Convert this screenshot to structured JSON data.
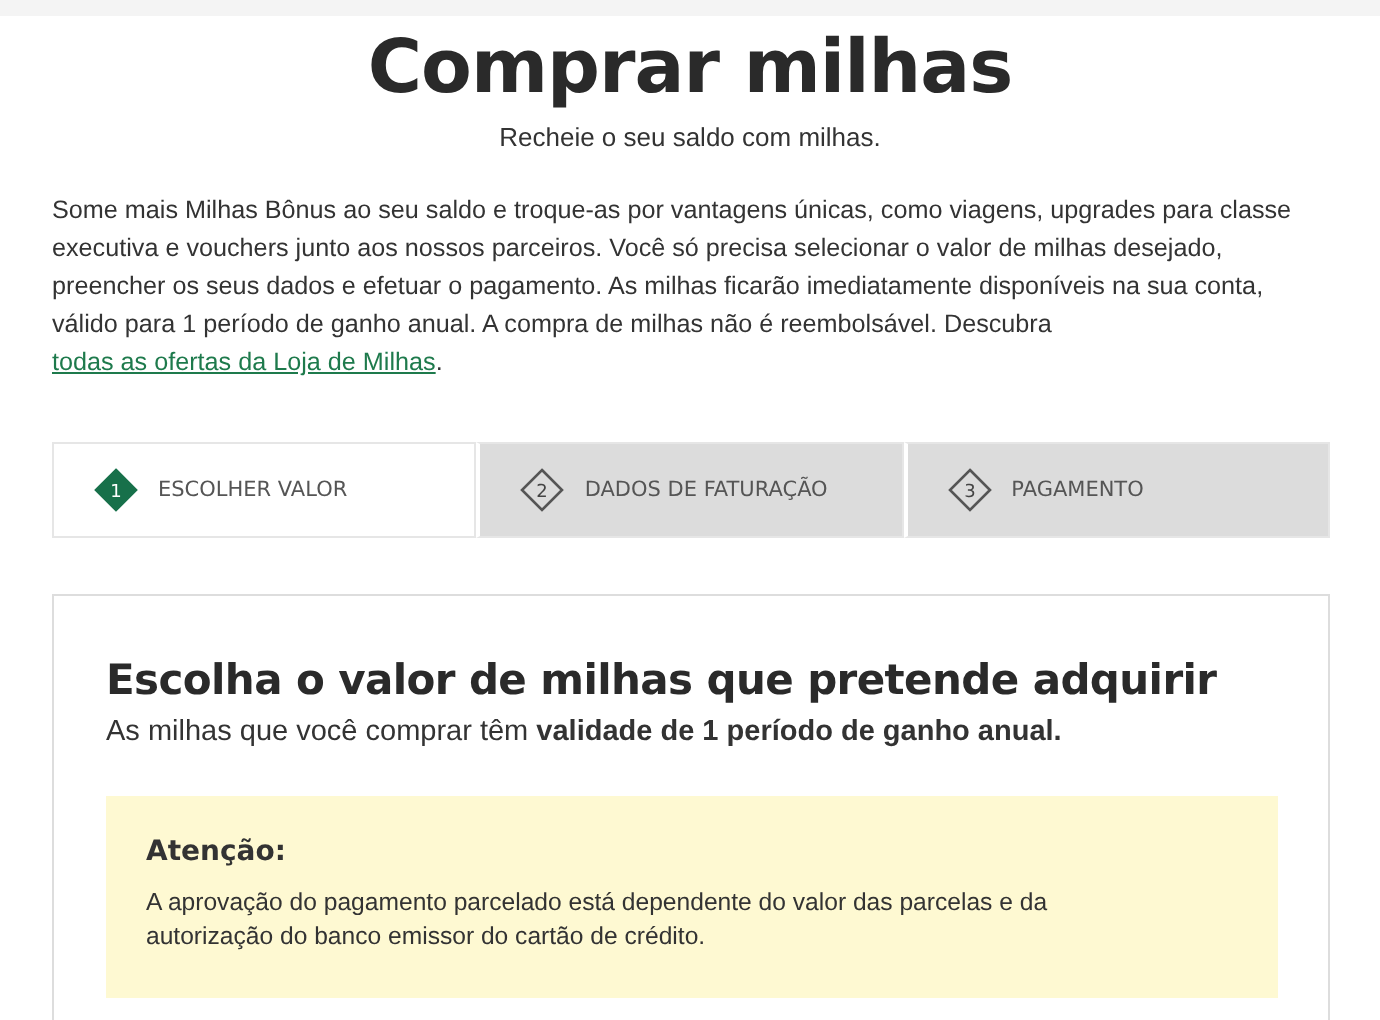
{
  "header": {
    "title": "Comprar milhas",
    "subtitle": "Recheie o seu saldo com milhas."
  },
  "intro": {
    "text": "Some mais Milhas Bônus ao seu saldo e troque-as por vantagens únicas, como viagens, upgrades para classe executiva e vouchers junto aos nossos parceiros. Você só precisa selecionar o valor de milhas desejado, preencher os seus dados e efetuar o pagamento. As milhas ficarão imediatamente disponíveis na sua conta, válido para 1 período de ganho anual. A compra de milhas não é reembolsável. Descubra",
    "link": "todas as ofertas da Loja de Milhas",
    "after": "."
  },
  "steps": [
    {
      "number": "1",
      "label": "ESCOLHER VALOR",
      "selected": true
    },
    {
      "number": "2",
      "label": "DADOS DE FATURAÇÃO",
      "selected": false
    },
    {
      "number": "3",
      "label": "PAGAMENTO",
      "selected": false
    }
  ],
  "card": {
    "title": "Escolha o valor de milhas que pretende adquirir",
    "subtitle": "As milhas que você comprar têm **validade de 1 período de ganho anual.**",
    "notice": {
      "title": "Atenção:",
      "text": "A aprovação do pagamento parcelado está dependente do valor das parcelas e da autorização do banco emissor do cartão de crédito."
    }
  }
}
